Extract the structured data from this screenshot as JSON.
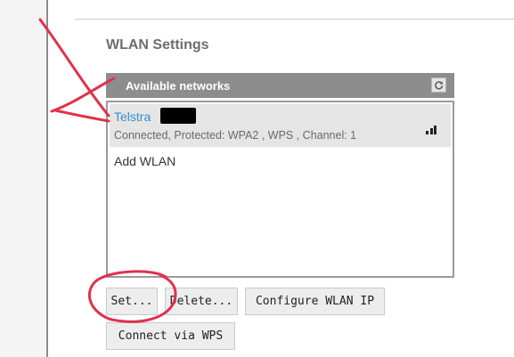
{
  "page_title": "WLAN Settings",
  "panel": {
    "title": "Available networks",
    "refresh_icon": "refresh-icon"
  },
  "networks": [
    {
      "name": "Telstra",
      "status": "Connected, Protected: WPA2 , WPS , Channel: 1",
      "signal_icon": "signal-bars-icon"
    }
  ],
  "add_wlan_label": "Add WLAN",
  "buttons": {
    "set": "Set...",
    "delete": "Delete...",
    "configure": "Configure WLAN IP",
    "wps": "Connect via WPS"
  },
  "colors": {
    "header_bg": "#8d8d8d",
    "network_name": "#3a8fd1",
    "selected_row": "#e5e5e5",
    "annotation": "#e0314b"
  }
}
